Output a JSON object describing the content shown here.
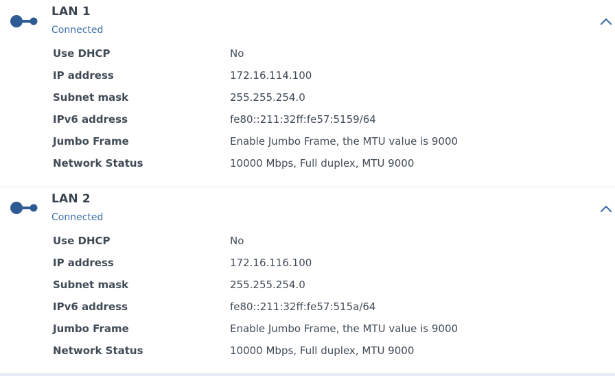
{
  "colors": {
    "accent": "#3d6fa8",
    "icon": "#2f5b95",
    "text": "#414b57"
  },
  "lans": [
    {
      "title": "LAN 1",
      "status": "Connected",
      "icon": "network-connector-icon",
      "collapse_icon": "chevron-up-icon",
      "rows": [
        {
          "label": "Use DHCP",
          "value": "No"
        },
        {
          "label": "IP address",
          "value": "172.16.114.100"
        },
        {
          "label": "Subnet mask",
          "value": "255.255.254.0"
        },
        {
          "label": "IPv6 address",
          "value": "fe80::211:32ff:fe57:5159/64"
        },
        {
          "label": "Jumbo Frame",
          "value": "Enable Jumbo Frame, the MTU value is 9000"
        },
        {
          "label": "Network Status",
          "value": "10000 Mbps, Full duplex, MTU 9000"
        }
      ]
    },
    {
      "title": "LAN 2",
      "status": "Connected",
      "icon": "network-connector-icon",
      "collapse_icon": "chevron-up-icon",
      "rows": [
        {
          "label": "Use DHCP",
          "value": "No"
        },
        {
          "label": "IP address",
          "value": "172.16.116.100"
        },
        {
          "label": "Subnet mask",
          "value": "255.255.254.0"
        },
        {
          "label": "IPv6 address",
          "value": "fe80::211:32ff:fe57:515a/64"
        },
        {
          "label": "Jumbo Frame",
          "value": "Enable Jumbo Frame, the MTU value is 9000"
        },
        {
          "label": "Network Status",
          "value": "10000 Mbps, Full duplex, MTU 9000"
        }
      ]
    }
  ]
}
